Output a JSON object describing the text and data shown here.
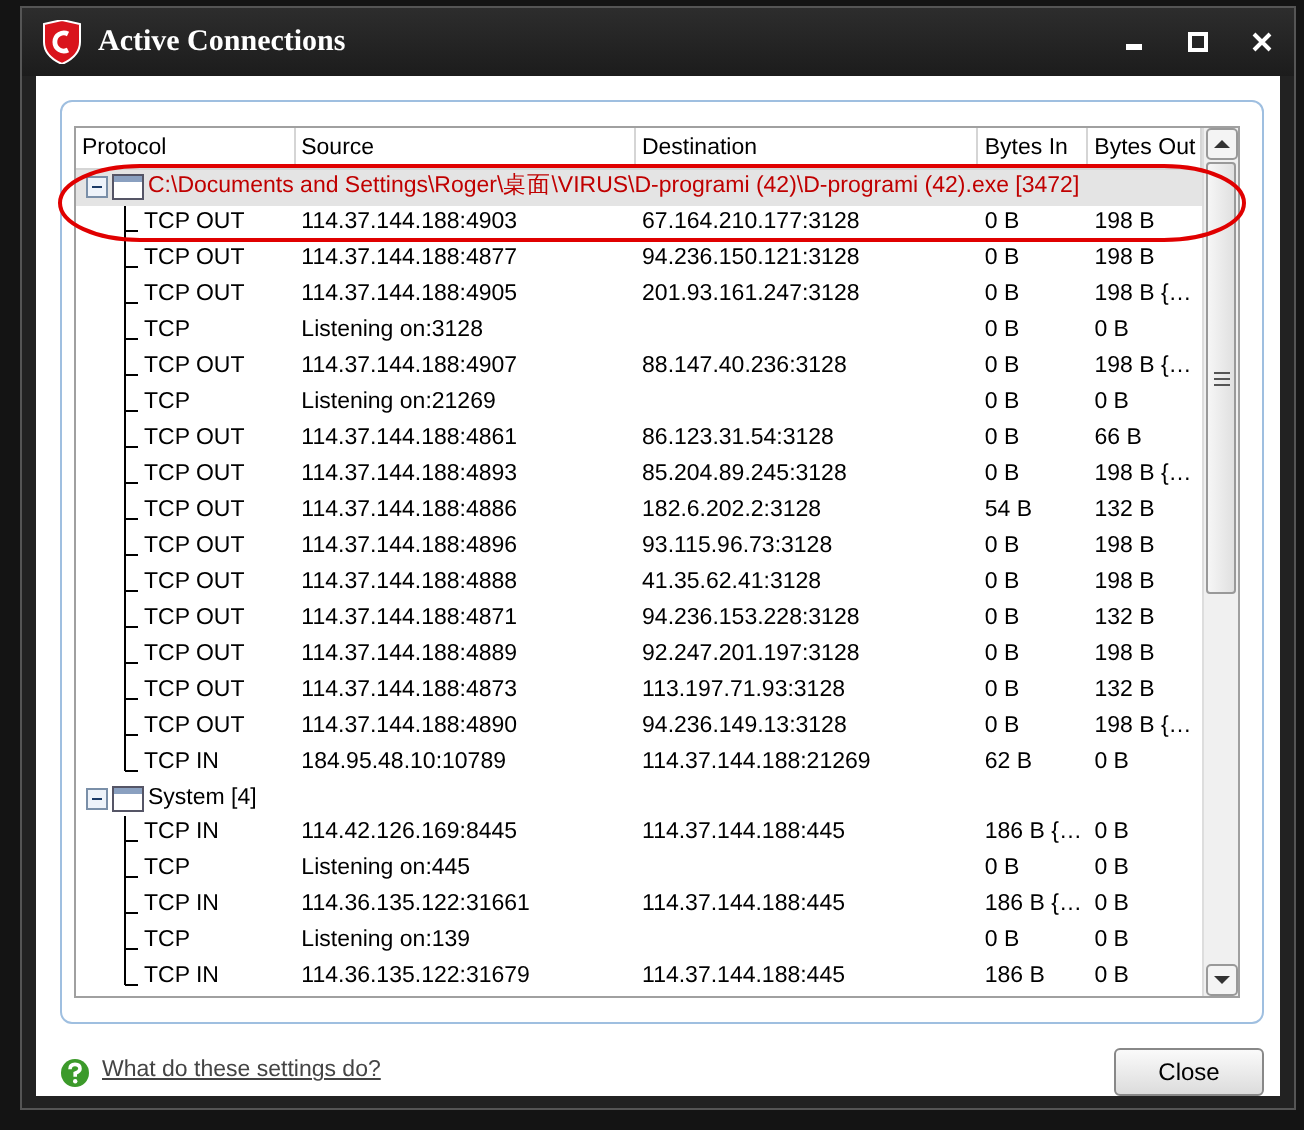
{
  "window": {
    "title": "Active Connections"
  },
  "table": {
    "columns": [
      "Protocol",
      "Source",
      "Destination",
      "Bytes In",
      "Bytes Out"
    ],
    "groups": [
      {
        "label": "C:\\Documents and Settings\\Roger\\桌面\\VIRUS\\D-programi (42)\\D-programi (42).exe [3472]",
        "selected": true,
        "expanded": true,
        "rows": [
          [
            "TCP OUT",
            "114.37.144.188:4903",
            "67.164.210.177:3128",
            "0 B",
            "198 B"
          ],
          [
            "TCP OUT",
            "114.37.144.188:4877",
            "94.236.150.121:3128",
            "0 B",
            "198 B"
          ],
          [
            "TCP OUT",
            "114.37.144.188:4905",
            "201.93.161.247:3128",
            "0 B",
            "198 B {…"
          ],
          [
            "TCP",
            "Listening on:3128",
            "",
            "0 B",
            "0 B"
          ],
          [
            "TCP OUT",
            "114.37.144.188:4907",
            "88.147.40.236:3128",
            "0 B",
            "198 B {…"
          ],
          [
            "TCP",
            "Listening on:21269",
            "",
            "0 B",
            "0 B"
          ],
          [
            "TCP OUT",
            "114.37.144.188:4861",
            "86.123.31.54:3128",
            "0 B",
            "66 B"
          ],
          [
            "TCP OUT",
            "114.37.144.188:4893",
            "85.204.89.245:3128",
            "0 B",
            "198 B {…"
          ],
          [
            "TCP OUT",
            "114.37.144.188:4886",
            "182.6.202.2:3128",
            "54 B",
            "132 B"
          ],
          [
            "TCP OUT",
            "114.37.144.188:4896",
            "93.115.96.73:3128",
            "0 B",
            "198 B"
          ],
          [
            "TCP OUT",
            "114.37.144.188:4888",
            "41.35.62.41:3128",
            "0 B",
            "198 B"
          ],
          [
            "TCP OUT",
            "114.37.144.188:4871",
            "94.236.153.228:3128",
            "0 B",
            "132 B"
          ],
          [
            "TCP OUT",
            "114.37.144.188:4889",
            "92.247.201.197:3128",
            "0 B",
            "198 B"
          ],
          [
            "TCP OUT",
            "114.37.144.188:4873",
            "113.197.71.93:3128",
            "0 B",
            "132 B"
          ],
          [
            "TCP OUT",
            "114.37.144.188:4890",
            "94.236.149.13:3128",
            "0 B",
            "198 B {…"
          ],
          [
            "TCP IN",
            "184.95.48.10:10789",
            "114.37.144.188:21269",
            "62 B",
            "0 B"
          ]
        ]
      },
      {
        "label": "System [4]",
        "selected": false,
        "expanded": true,
        "rows": [
          [
            "TCP IN",
            "114.42.126.169:8445",
            "114.37.144.188:445",
            "186 B {…",
            "0 B"
          ],
          [
            "TCP",
            "Listening on:445",
            "",
            "0 B",
            "0 B"
          ],
          [
            "TCP IN",
            "114.36.135.122:31661",
            "114.37.144.188:445",
            "186 B {…",
            "0 B"
          ],
          [
            "TCP",
            "Listening on:139",
            "",
            "0 B",
            "0 B"
          ],
          [
            "TCP IN",
            "114.36.135.122:31679",
            "114.37.144.188:445",
            "186 B",
            "0 B"
          ]
        ]
      }
    ]
  },
  "help_link": "What do these settings do?",
  "buttons": [
    "Close"
  ]
}
